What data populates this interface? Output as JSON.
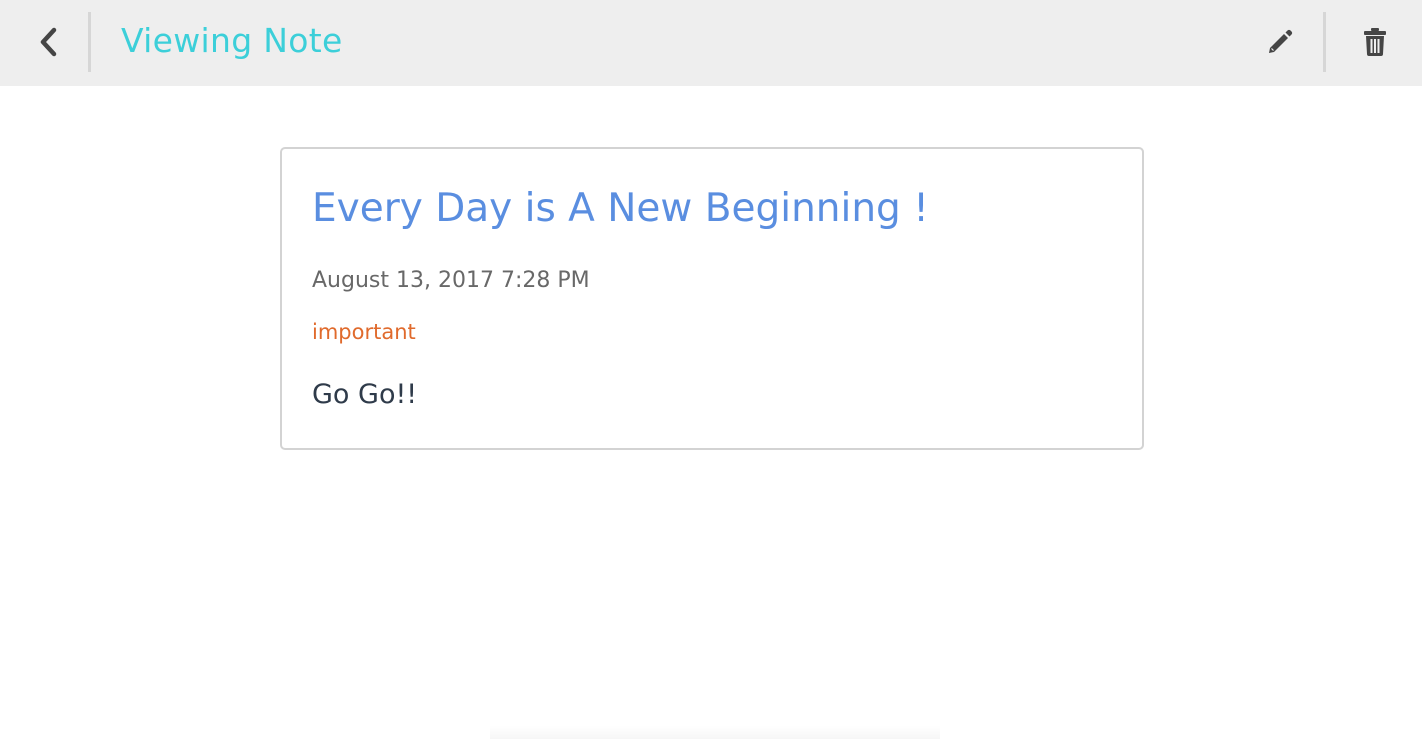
{
  "header": {
    "title": "Viewing Note",
    "back_icon": "chevron-left-icon",
    "edit_icon": "pencil-icon",
    "delete_icon": "trash-icon",
    "title_color": "#3ccfd9"
  },
  "note": {
    "title": "Every Day is A New Beginning !",
    "date": "August 13, 2017 7:28 PM",
    "tag": "important",
    "body": "Go Go!!",
    "title_color": "#5a8ee0",
    "tag_color": "#e06a2c"
  }
}
